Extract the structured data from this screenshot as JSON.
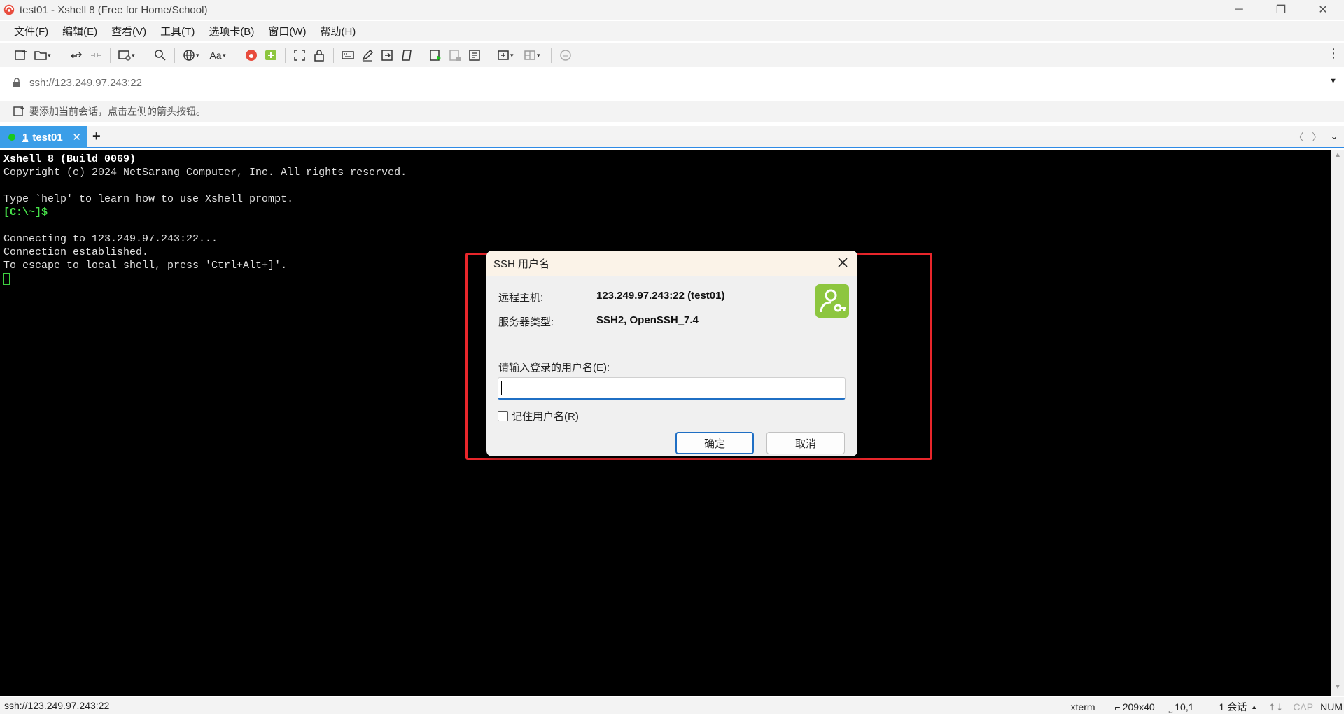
{
  "window": {
    "title": "test01 - Xshell 8 (Free for Home/School)",
    "minimize_glyph": "─",
    "restore_glyph": "❐",
    "close_glyph": "✕"
  },
  "menu": {
    "items": [
      "文件(F)",
      "编辑(E)",
      "查看(V)",
      "工具(T)",
      "选项卡(B)",
      "窗口(W)",
      "帮助(H)"
    ]
  },
  "toolbar": {
    "font_label": "Aa",
    "more_glyph": "⋮",
    "dropdown_glyph": "▾"
  },
  "address": {
    "value": "ssh://123.249.97.243:22",
    "dropdown_glyph": "▼"
  },
  "hint": {
    "text": "要添加当前会话，点击左侧的箭头按钮。"
  },
  "tabs": {
    "active": {
      "number": "1",
      "label": "test01",
      "close": "✕"
    },
    "add_glyph": "+",
    "prev_glyph": "〈",
    "next_glyph": "〉",
    "list_glyph": "⌄"
  },
  "terminal": {
    "lines": [
      "Xshell 8 (Build 0069)",
      "Copyright (c) 2024 NetSarang Computer, Inc. All rights reserved.",
      "",
      "Type `help' to learn how to use Xshell prompt.",
      "[C:\\~]$",
      "",
      "Connecting to 123.249.97.243:22...",
      "Connection established.",
      "To escape to local shell, press 'Ctrl+Alt+]'."
    ]
  },
  "dialog": {
    "title": "SSH 用户名",
    "remote_host_label": "远程主机:",
    "remote_host_value": "123.249.97.243:22 (test01)",
    "server_type_label": "服务器类型:",
    "server_type_value": "SSH2, OpenSSH_7.4",
    "prompt_label": "请输入登录的用户名(E):",
    "username_value": "",
    "remember_label": "记住用户名(R)",
    "remember_checked": false,
    "ok_label": "确定",
    "cancel_label": "取消"
  },
  "statusbar": {
    "left": "ssh://123.249.97.243:22",
    "term_type": "xterm",
    "size": "209x40",
    "position": "10,1",
    "sessions": "1 会话",
    "cap": "CAP",
    "num": "NUM"
  },
  "colors": {
    "accent": "#3b9ee8",
    "highlight_border": "#e8262b",
    "prompt_green": "#47e34a",
    "logo_green": "#8dc63f"
  }
}
